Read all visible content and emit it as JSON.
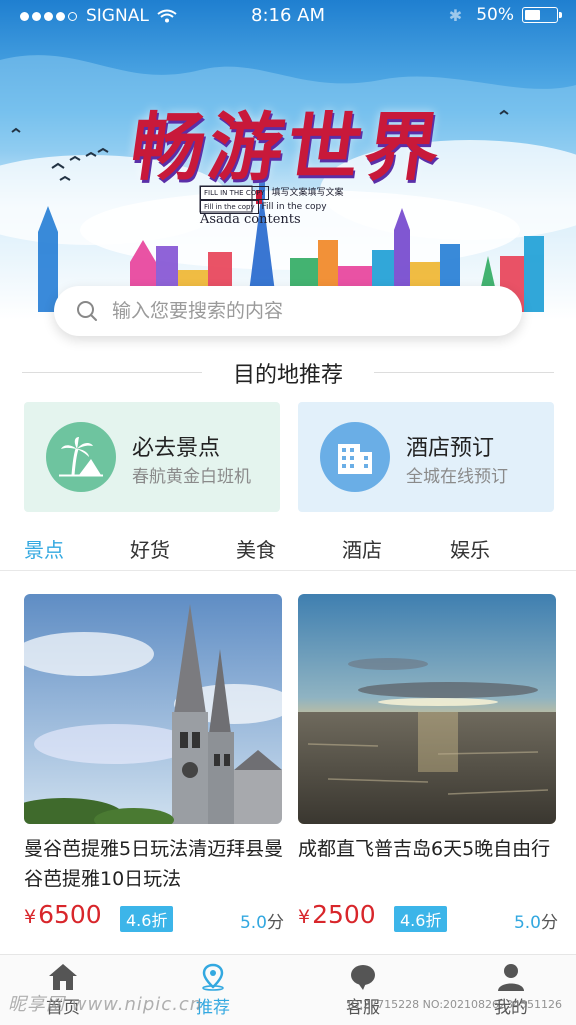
{
  "status_bar": {
    "carrier": "SIGNAL",
    "time": "8:16 AM",
    "battery": "50%",
    "battery_level": 0.5
  },
  "hero": {
    "title": "畅游世界",
    "sub_box": "FILL IN THE COPY",
    "sub_box2": "Fill in the copy",
    "sub_line1": "填写文案填写文案",
    "sub_line2": "Fill in the copy",
    "sub_big": "Asada contents"
  },
  "search": {
    "placeholder": "输入您要搜索的内容"
  },
  "section": {
    "title": "目的地推荐"
  },
  "promo": [
    {
      "title": "必去景点",
      "subtitle": "春航黄金白班机",
      "icon": "palm-tree-icon",
      "color": "#6ec49f"
    },
    {
      "title": "酒店预订",
      "subtitle": "全城在线预订",
      "icon": "building-icon",
      "color": "#6aaee6"
    }
  ],
  "tabs": [
    {
      "label": "景点",
      "active": true
    },
    {
      "label": "好货",
      "active": false
    },
    {
      "label": "美食",
      "active": false
    },
    {
      "label": "酒店",
      "active": false
    },
    {
      "label": "娱乐",
      "active": false
    }
  ],
  "products": [
    {
      "name": "曼谷芭提雅5日玩法清迈拜县曼谷芭提雅10日玩法",
      "currency": "¥",
      "price": "6500",
      "discount": "4.6折",
      "score": "5.0",
      "score_unit": "分",
      "image": "church-photo"
    },
    {
      "name": "成都直飞普吉岛6天5晚自由行",
      "currency": "¥",
      "price": "2500",
      "discount": "4.6折",
      "score": "5.0",
      "score_unit": "分",
      "image": "sunset-sea-photo"
    }
  ],
  "nav": [
    {
      "label": "首页",
      "icon": "home-icon",
      "active": false
    },
    {
      "label": "推荐",
      "icon": "location-pin-icon",
      "active": true
    },
    {
      "label": "客服",
      "icon": "chat-bubble-icon",
      "active": false
    },
    {
      "label": "我的",
      "icon": "user-icon",
      "active": false
    }
  ],
  "watermark": {
    "brand": "昵享网 www.nipic.cn",
    "id": "ID:27715228 NO:20210826234551126"
  },
  "colors": {
    "accent": "#33a8e0",
    "price": "#d8262b",
    "discount_bg": "#3cb5e9"
  }
}
